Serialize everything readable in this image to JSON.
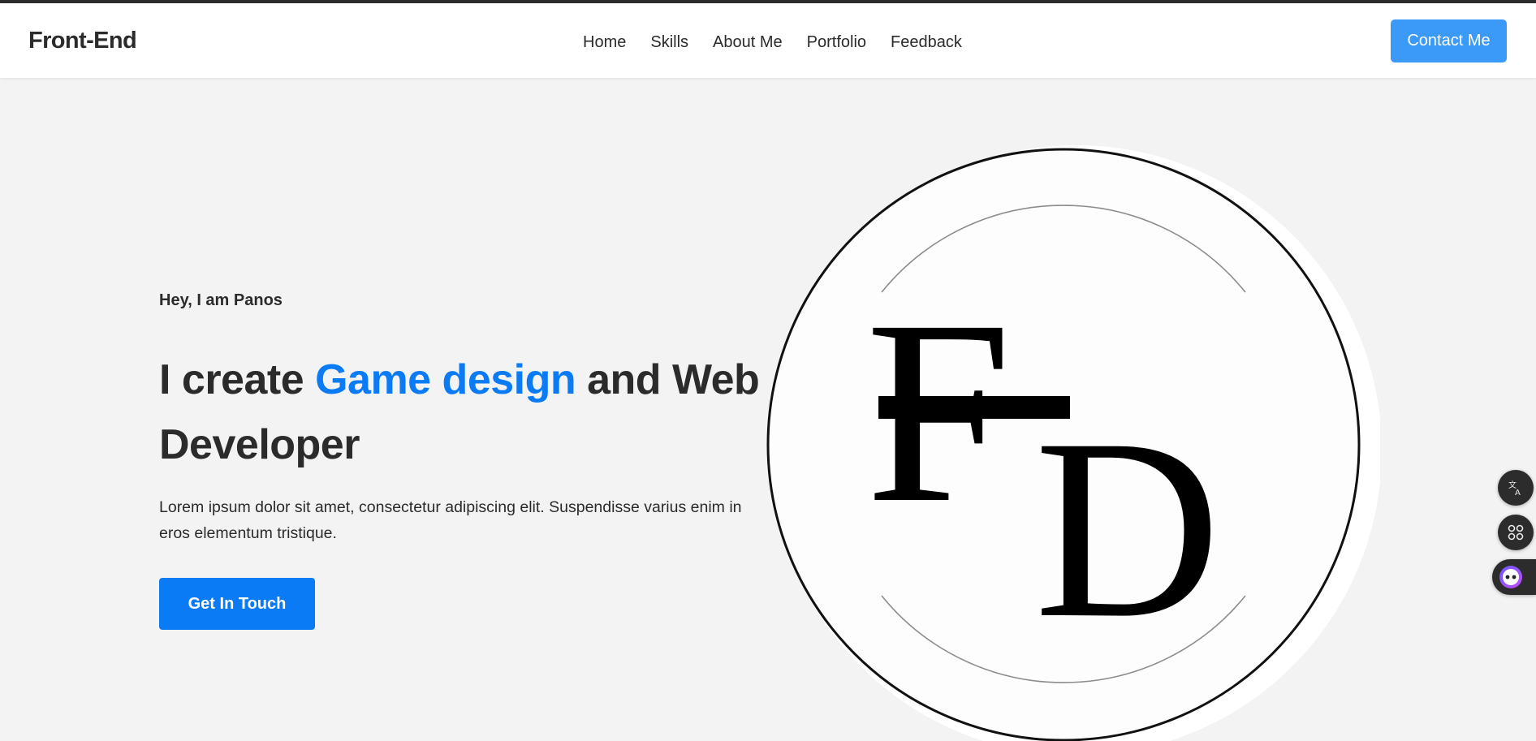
{
  "header": {
    "brand": "Front-End",
    "nav": [
      "Home",
      "Skills",
      "About Me",
      "Portfolio",
      "Feedback"
    ],
    "contact_label": "Contact Me"
  },
  "hero": {
    "greeting": "Hey, I am Panos",
    "title_pre": "I create ",
    "title_accent": "Game design",
    "title_post": " and Web Developer",
    "description": "Lorem ipsum dolor sit amet, consectetur adipiscing elit. Suspendisse varius enim in eros elementum tristique.",
    "cta_label": "Get In Touch"
  },
  "logo": {
    "letter_1": "F",
    "letter_2": "D"
  },
  "floating": {
    "icons": [
      "translate-icon",
      "apps-grid-icon",
      "assistant-icon"
    ]
  },
  "colors": {
    "accent": "#0b7bf5",
    "contact_button": "#3b99f8",
    "text": "#2b2b2b",
    "background": "#f3f3f3"
  }
}
